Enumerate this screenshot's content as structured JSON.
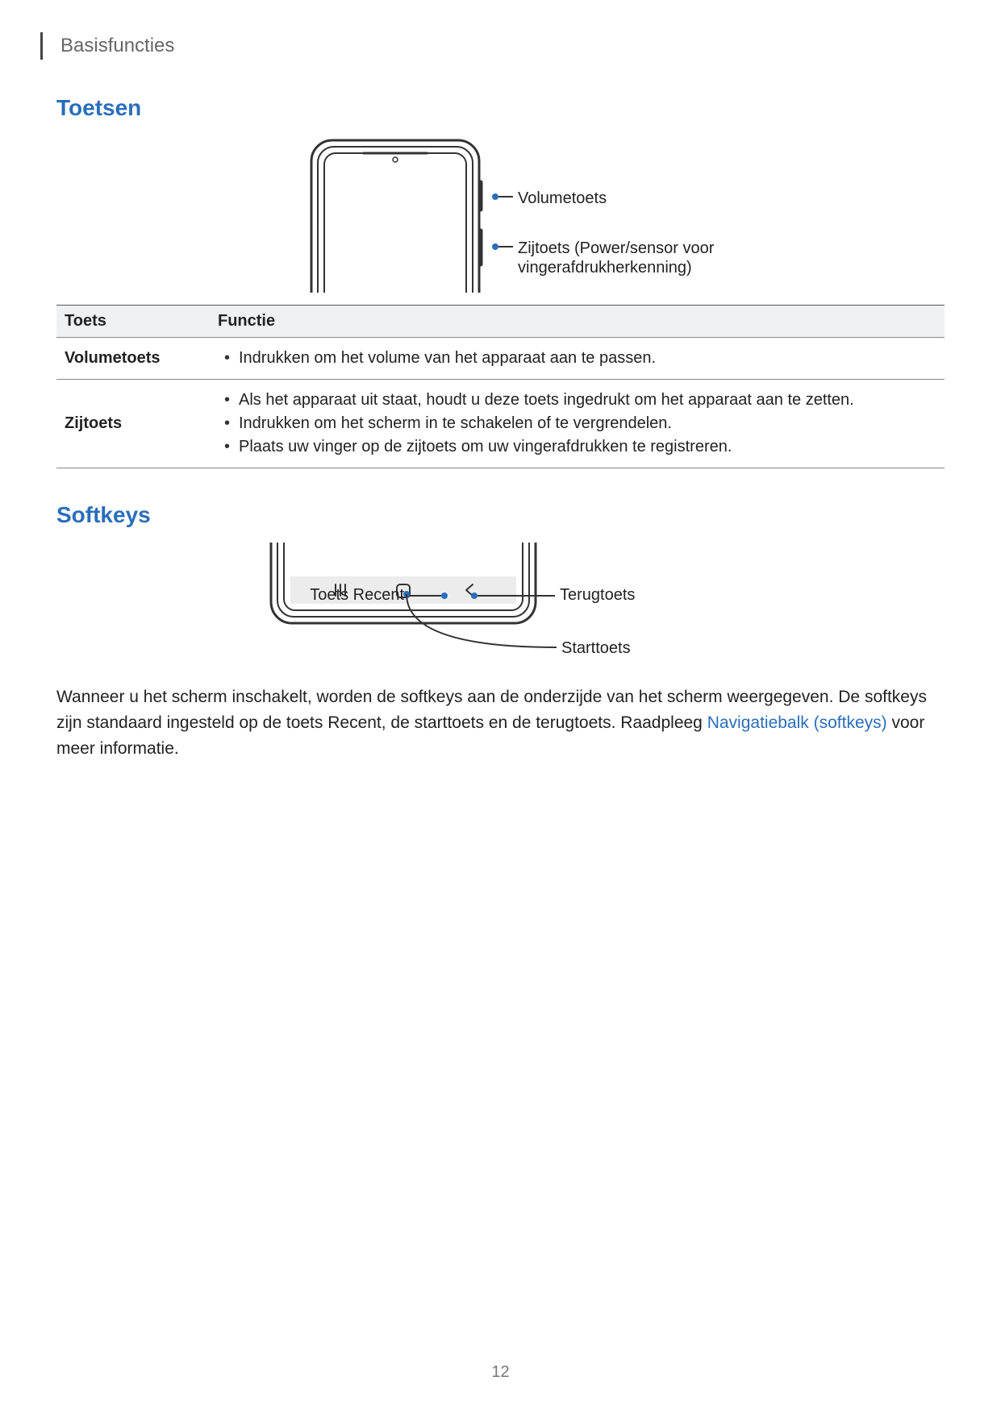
{
  "header": {
    "running_title": "Basisfuncties"
  },
  "sections": {
    "toetsen": {
      "title": "Toetsen"
    },
    "softkeys": {
      "title": "Softkeys"
    }
  },
  "fig1": {
    "callouts": {
      "volume": "Volumetoets",
      "side": "Zijtoets (Power/sensor voor vingerafdrukherkenning)"
    }
  },
  "table": {
    "head": {
      "toets": "Toets",
      "functie": "Functie"
    },
    "rows": {
      "volume": {
        "label": "Volumetoets",
        "items": [
          "Indrukken om het volume van het apparaat aan te passen."
        ]
      },
      "zij": {
        "label": "Zijtoets",
        "items": [
          "Als het apparaat uit staat, houdt u deze toets ingedrukt om het apparaat aan te zetten.",
          "Indrukken om het scherm in te schakelen of te vergrendelen.",
          "Plaats uw vinger op de zijtoets om uw vingerafdrukken te registreren."
        ]
      }
    }
  },
  "fig2": {
    "callouts": {
      "recent": "Toets Recent",
      "back": "Terugtoets",
      "home": "Starttoets"
    }
  },
  "paragraph": {
    "part1": "Wanneer u het scherm inschakelt, worden de softkeys aan de onderzijde van het scherm weergegeven. De softkeys zijn standaard ingesteld op de toets Recent, de starttoets en de terugtoets. Raadpleeg ",
    "link": "Navigatiebalk (softkeys)",
    "part2": " voor meer informatie."
  },
  "page_number": "12"
}
